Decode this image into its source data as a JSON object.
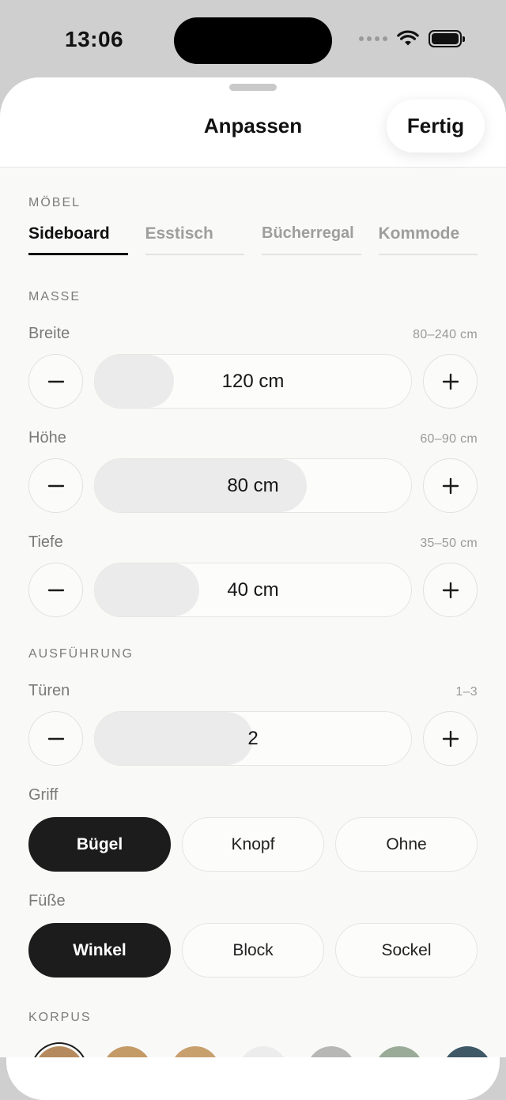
{
  "status": {
    "time": "13:06"
  },
  "sheet": {
    "title": "Anpassen",
    "done_label": "Fertig"
  },
  "furniture": {
    "section": "MÖBEL",
    "tabs": [
      {
        "label": "Sideboard",
        "active": true
      },
      {
        "label": "Esstisch",
        "active": false
      },
      {
        "label": "Bücherregal",
        "active": false
      },
      {
        "label": "Kommode",
        "active": false
      }
    ]
  },
  "dimensions": {
    "section": "MASSE",
    "fields": [
      {
        "label": "Breite",
        "range": "80–240 cm",
        "value": "120 cm",
        "fill_fraction": 0.25
      },
      {
        "label": "Höhe",
        "range": "60–90 cm",
        "value": "80 cm",
        "fill_fraction": 0.67
      },
      {
        "label": "Tiefe",
        "range": "35–50 cm",
        "value": "40 cm",
        "fill_fraction": 0.33
      }
    ]
  },
  "finish": {
    "section": "AUSFÜHRUNG",
    "doors": {
      "label": "Türen",
      "range": "1–3",
      "value": "2",
      "fill_fraction": 0.5
    },
    "handle": {
      "label": "Griff",
      "options": [
        "Bügel",
        "Knopf",
        "Ohne"
      ],
      "selected": "Bügel"
    },
    "feet": {
      "label": "Füße",
      "options": [
        "Winkel",
        "Block",
        "Sockel"
      ],
      "selected": "Winkel"
    }
  },
  "body": {
    "section": "KORPUS",
    "swatch_colors": [
      "#b58a5e",
      "#c49a66",
      "#c8a06e",
      "#ececec",
      "#b7b7b5",
      "#9aab98",
      "#3f5966"
    ]
  }
}
